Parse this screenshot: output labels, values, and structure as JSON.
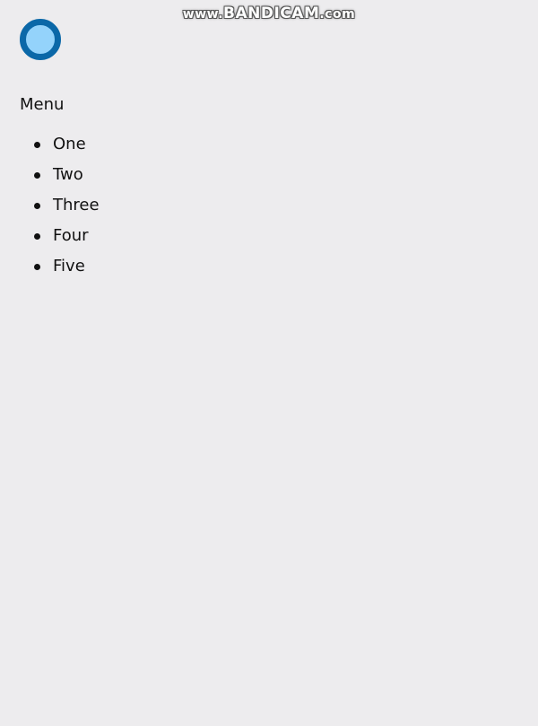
{
  "watermark": {
    "prefix": "www.",
    "brand": "BANDICAM",
    "suffix": ".com"
  },
  "colors": {
    "background": "#edecee",
    "logo_ring": "#0b68a8",
    "logo_fill": "#94d3fb",
    "text": "#111111"
  },
  "logo": {
    "icon": "circle-logo-icon"
  },
  "menu": {
    "title": "Menu",
    "items": [
      {
        "label": "One"
      },
      {
        "label": "Two"
      },
      {
        "label": "Three"
      },
      {
        "label": "Four"
      },
      {
        "label": "Five"
      }
    ]
  }
}
